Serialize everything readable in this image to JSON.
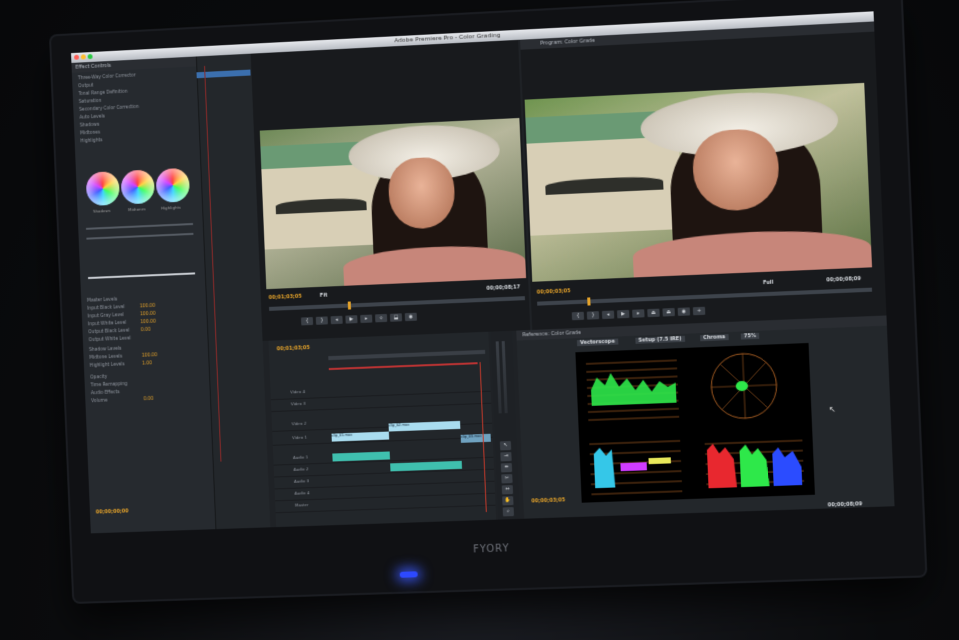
{
  "window": {
    "title": "Adobe Premiere Pro - Color Grading"
  },
  "monitor_brand": "FYORY",
  "effect_controls": {
    "tab_label": "Effect Controls",
    "wheels": [
      {
        "name": "Shadows"
      },
      {
        "name": "Midtones"
      },
      {
        "name": "Highlights"
      }
    ],
    "rows": [
      "Three-Way Color Corrector",
      "Output",
      "Tonal Range Definition",
      "Saturation",
      "Secondary Color Correction",
      "Auto Levels",
      "Shadows",
      "Midtones",
      "Highlights",
      "Master Levels",
      "Input Black Level",
      "Input Gray Level",
      "Input White Level",
      "Output Black Level",
      "Output White Level",
      "Shadow Levels",
      "Midtone Levels",
      "Highlight Levels",
      "Opacity",
      "Time Remapping",
      "Audio Effects",
      "Volume"
    ],
    "values": [
      "100.00",
      "100.00",
      "100.00",
      "0.00",
      "1.00",
      "100.00",
      "0.00"
    ],
    "timecode": "00;00;00;00"
  },
  "source_monitor": {
    "timecode_in": "00;01;03;05",
    "zoom": "Fit",
    "timecode_out": "00;00;08;17"
  },
  "program_monitor": {
    "tab_label": "Program: Color Grade",
    "timecode_in": "00;00;03;05",
    "zoom": "Full",
    "timecode_out": "00;00;08;09"
  },
  "timeline": {
    "timecode": "00;01;03;05",
    "tracks": [
      "Video 4",
      "Video 3",
      "Video 2",
      "Video 1",
      "Audio 1",
      "Audio 2",
      "Audio 3",
      "Audio 4",
      "Master"
    ],
    "clips": [
      {
        "label": "clip_01.mov"
      },
      {
        "label": "clip_02.mov"
      },
      {
        "label": "clip_03.mov"
      }
    ]
  },
  "reference_monitor": {
    "tab_label": "Reference: Color Grade",
    "scope_dropdown": "Vectorscope",
    "mode_dropdown": "Setup (7.5 IRE)",
    "color_dropdown": "Chroma",
    "percent_dropdown": "75%",
    "timecode_in": "00;00;03;05",
    "timecode_out": "00;00;08;09"
  },
  "colors": {
    "accent_timecode": "#e5a32a",
    "clip_video": "#9fd6ea",
    "clip_audio": "#3fbfae",
    "power_led": "#2d49ff"
  }
}
